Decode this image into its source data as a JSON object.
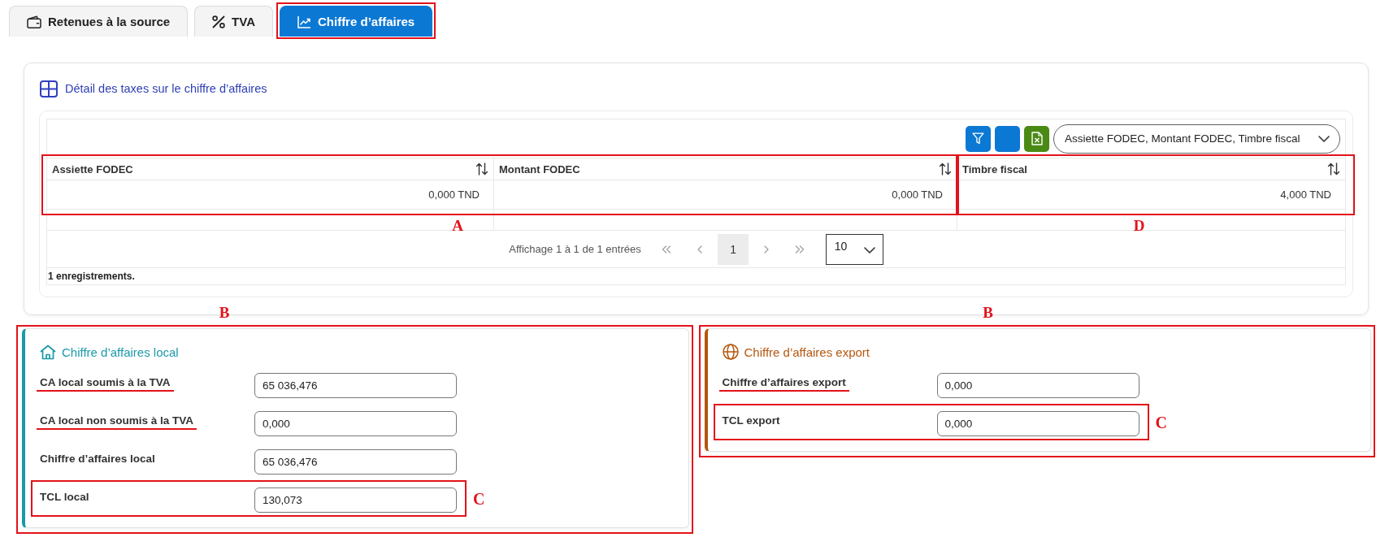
{
  "tabs": [
    {
      "label": "Retenues à la source",
      "selected": false,
      "boxed": false
    },
    {
      "label": "TVA",
      "selected": false,
      "boxed": false
    },
    {
      "label": "Chiffre d’affaires",
      "selected": true,
      "boxed": true
    }
  ],
  "details_card": {
    "title": "Détail des taxes sur le chiffre d’affaires",
    "toolbar_buttons": [
      {
        "kind": "filter"
      },
      {
        "kind": "blank"
      },
      {
        "kind": "excel"
      }
    ],
    "column_picker": {
      "value": "Assiette FODEC, Montant FODEC, Timbre fiscal"
    },
    "table": {
      "column_groups": [
        {
          "boxed": true,
          "box_label": "A",
          "columns": [
            {
              "header": "Assiette FODEC",
              "sortable": true,
              "values": [
                "0,000 TND"
              ]
            },
            {
              "header": "Montant FODEC",
              "sortable": true,
              "values": [
                "0,000 TND"
              ]
            }
          ]
        },
        {
          "boxed": true,
          "box_label": "D",
          "columns": [
            {
              "header": "Timbre fiscal",
              "sortable": true,
              "values": [
                "4,000 TND"
              ]
            }
          ]
        }
      ]
    },
    "pagination": {
      "summary": "Affichage 1 à 1 de 1 entrées",
      "first": {
        "disabled": true
      },
      "previous": {
        "disabled": true
      },
      "pages": [
        {
          "label": "1",
          "selected": true
        }
      ],
      "next": {
        "disabled": true
      },
      "last": {
        "disabled": true
      },
      "page_size": {
        "value": "10"
      }
    },
    "record_count": "1 enregistrements."
  },
  "panels": [
    {
      "title": "Chiffre d’affaires local",
      "color": "#1a9aa8",
      "boxed": true,
      "box_label": "B",
      "fields": [
        {
          "label": "CA local soumis à la TVA",
          "value": "65 036,476",
          "underlined": true,
          "boxed": false
        },
        {
          "label": "CA local non soumis à la TVA",
          "value": "0,000",
          "underlined": true,
          "boxed": false
        },
        {
          "label": "Chiffre d’affaires local",
          "value": "65 036,476",
          "underlined": false,
          "boxed": false
        },
        {
          "label": "TCL local",
          "value": "130,073",
          "underlined": false,
          "boxed": true,
          "box_label": "C"
        }
      ]
    },
    {
      "title": "Chiffre d’affaires export",
      "color": "#b5560e",
      "boxed": true,
      "box_label": "B",
      "fields": [
        {
          "label": "Chiffre d’affaires export",
          "value": "0,000",
          "underlined": true,
          "boxed": false
        },
        {
          "label": "TCL export",
          "value": "0,000",
          "underlined": false,
          "boxed": true,
          "box_label": "C"
        }
      ]
    }
  ]
}
